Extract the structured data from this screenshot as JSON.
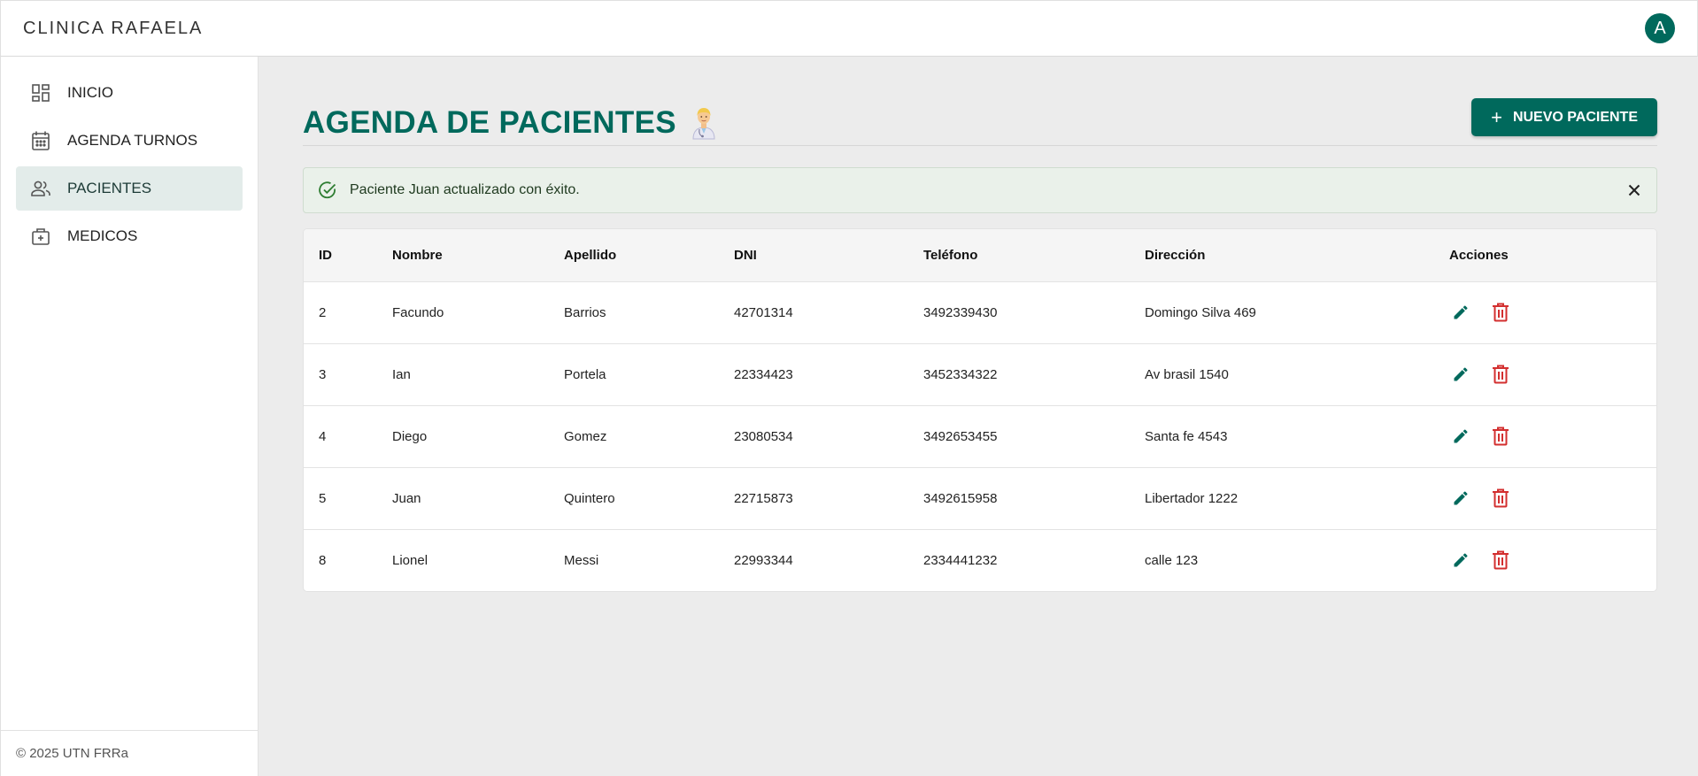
{
  "app": {
    "brand": "CLINICA RAFAELA",
    "avatar_letter": "A"
  },
  "sidebar": {
    "items": [
      {
        "label": "INICIO",
        "icon": "dashboard-icon"
      },
      {
        "label": "AGENDA TURNOS",
        "icon": "calendar-icon"
      },
      {
        "label": "PACIENTES",
        "icon": "people-icon",
        "active": true
      },
      {
        "label": "MEDICOS",
        "icon": "medical-bag-icon"
      }
    ],
    "footer": "© 2025 UTN FRRa"
  },
  "page": {
    "title": "AGENDA DE PACIENTES",
    "title_emoji": "doctor-emoji",
    "new_button": "NUEVO PACIENTE"
  },
  "alert": {
    "text": "Paciente Juan actualizado con éxito."
  },
  "table": {
    "columns": [
      "ID",
      "Nombre",
      "Apellido",
      "DNI",
      "Teléfono",
      "Dirección",
      "Acciones"
    ],
    "rows": [
      {
        "id": "2",
        "nombre": "Facundo",
        "apellido": "Barrios",
        "dni": "42701314",
        "telefono": "3492339430",
        "direccion": "Domingo Silva 469"
      },
      {
        "id": "3",
        "nombre": "Ian",
        "apellido": "Portela",
        "dni": "22334423",
        "telefono": "3452334322",
        "direccion": "Av brasil 1540"
      },
      {
        "id": "4",
        "nombre": "Diego",
        "apellido": "Gomez",
        "dni": "23080534",
        "telefono": "3492653455",
        "direccion": "Santa fe 4543"
      },
      {
        "id": "5",
        "nombre": "Juan",
        "apellido": "Quintero",
        "dni": "22715873",
        "telefono": "3492615958",
        "direccion": "Libertador 1222"
      },
      {
        "id": "8",
        "nombre": "Lionel",
        "apellido": "Messi",
        "dni": "22993344",
        "telefono": "2334441232",
        "direccion": "calle 123"
      }
    ]
  },
  "colors": {
    "primary": "#00695c",
    "danger": "#d32f2f",
    "alert_bg": "#eaf1ea"
  }
}
